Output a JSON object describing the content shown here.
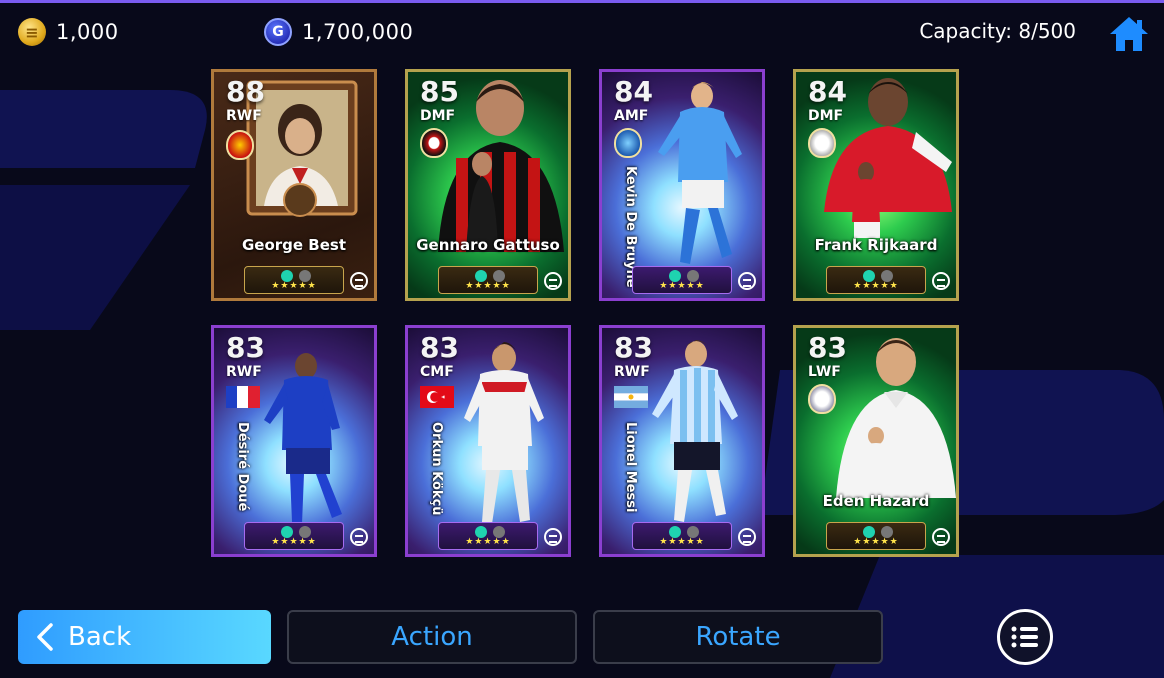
{
  "header": {
    "coins_icon": "coin-icon",
    "coins_value": "1,000",
    "gp_icon": "gp-icon",
    "gp_label": "G",
    "gp_value": "1,700,000",
    "capacity": "Capacity: 8/500",
    "home_icon": "home-icon"
  },
  "cards": [
    {
      "rating": "88",
      "position": "RWF",
      "name": "George Best",
      "style": "legend"
    },
    {
      "rating": "85",
      "position": "DMF",
      "name": "Gennaro Gattuso",
      "style": "green"
    },
    {
      "rating": "84",
      "position": "AMF",
      "name": "Kevin De Bruyne",
      "style": "purple"
    },
    {
      "rating": "84",
      "position": "DMF",
      "name": "Frank Rijkaard",
      "style": "green"
    },
    {
      "rating": "83",
      "position": "RWF",
      "name": "Désiré Doué",
      "style": "purple"
    },
    {
      "rating": "83",
      "position": "CMF",
      "name": "Orkun Kökçü",
      "style": "purple"
    },
    {
      "rating": "83",
      "position": "RWF",
      "name": "Lionel Messi",
      "style": "purple"
    },
    {
      "rating": "83",
      "position": "LWF",
      "name": "Eden Hazard",
      "style": "green"
    }
  ],
  "card_stars": "★★★★★",
  "footer": {
    "back_label": "Back",
    "action_label": "Action",
    "rotate_label": "Rotate",
    "menu_icon": "list-menu-icon"
  },
  "colors": {
    "accent_blue": "#3aa6ff",
    "back_gradient_start": "#2f9cff",
    "back_gradient_end": "#59d8ff",
    "background": "#08091a"
  }
}
